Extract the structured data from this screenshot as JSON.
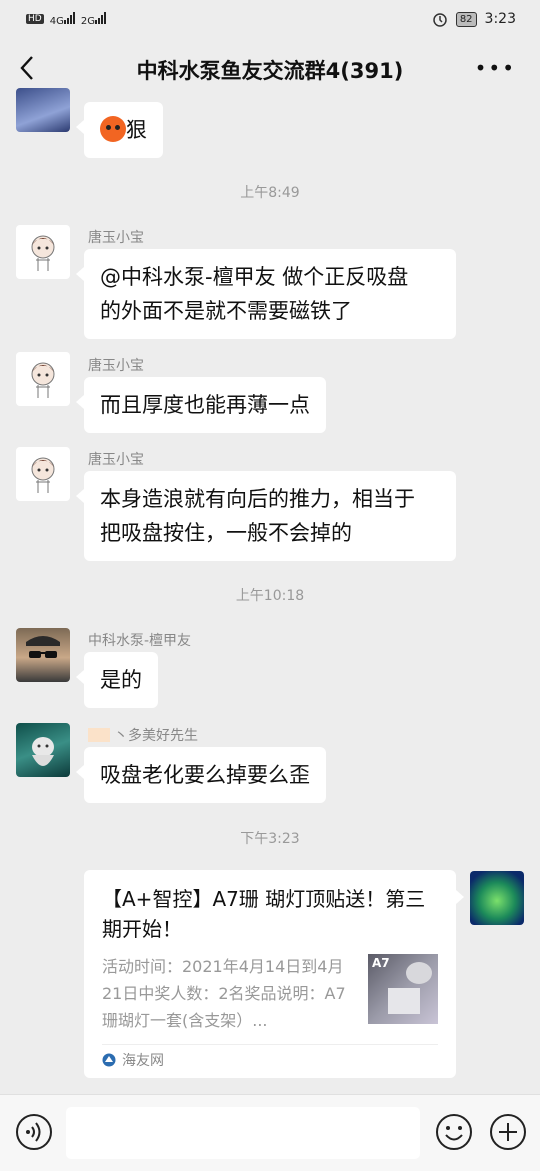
{
  "status_bar": {
    "left": "HD 4G 2G",
    "battery": "82",
    "time": "3:23"
  },
  "header": {
    "title": "中科水泵鱼友交流群4(391)",
    "more": "•••"
  },
  "messages": {
    "m0": {
      "text": "狠"
    },
    "t1": "上午8:49",
    "m1": {
      "sender": "唐玉小宝",
      "line1": "@中科水泵-檀甲友  做个正反吸盘",
      "line2": "的外面不是就不需要磁铁了"
    },
    "m2": {
      "sender": "唐玉小宝",
      "text": "而且厚度也能再薄一点"
    },
    "m3": {
      "sender": "唐玉小宝",
      "line1": "本身造浪就有向后的推力，相当于",
      "line2": "把吸盘按住，一般不会掉的"
    },
    "t2": "上午10:18",
    "m4": {
      "sender": "中科水泵-檀甲友",
      "text": "是的"
    },
    "m5": {
      "sender": "丶多美好先生",
      "text": "吸盘老化要么掉要么歪"
    },
    "t3": "下午3:23",
    "card": {
      "title": "【A+智控】A7珊 瑚灯顶贴送！第三期开始！",
      "desc": "活动时间：2021年4月14日到4月21日中奖人数：2名奖品说明：A7珊瑚灯一套(含支架）...",
      "thumb_label": "A7",
      "source": "海友网"
    }
  },
  "input_bar": {
    "placeholder": ""
  }
}
